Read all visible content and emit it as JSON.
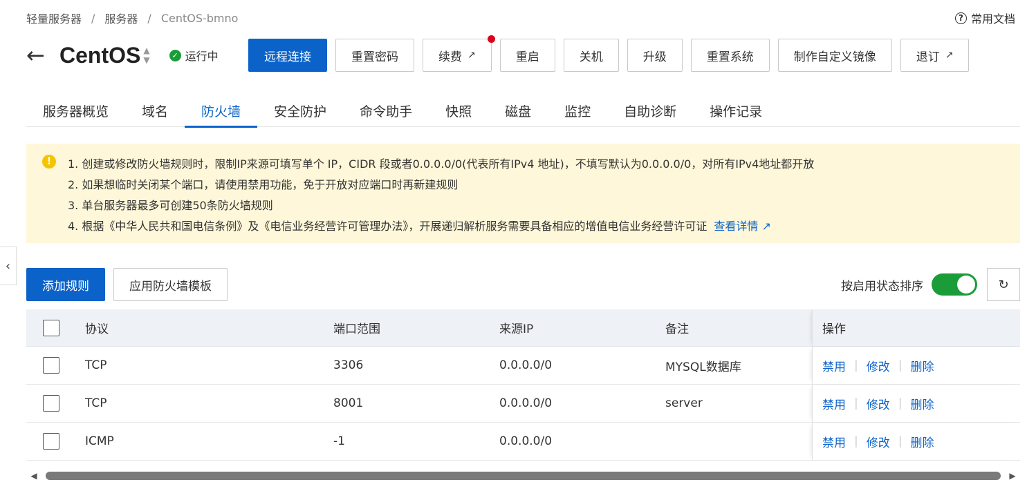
{
  "breadcrumb": [
    "轻量服务器",
    "服务器",
    "CentOS-bmno"
  ],
  "docs_link": "常用文档",
  "title": "CentOS",
  "status": "运行中",
  "actions": [
    {
      "label": "远程连接",
      "primary": true
    },
    {
      "label": "重置密码"
    },
    {
      "label": "续费",
      "external": true,
      "badge": true
    },
    {
      "label": "重启"
    },
    {
      "label": "关机"
    },
    {
      "label": "升级"
    },
    {
      "label": "重置系统"
    },
    {
      "label": "制作自定义镜像"
    },
    {
      "label": "退订",
      "external": true
    }
  ],
  "tabs": [
    "服务器概览",
    "域名",
    "防火墙",
    "安全防护",
    "命令助手",
    "快照",
    "磁盘",
    "监控",
    "自助诊断",
    "操作记录"
  ],
  "active_tab": "防火墙",
  "notice": {
    "lines": [
      "1. 创建或修改防火墙规则时，限制IP来源可填写单个 IP，CIDR 段或者0.0.0.0/0(代表所有IPv4 地址)，不填写默认为0.0.0.0/0，对所有IPv4地址都开放",
      "2. 如果想临时关闭某个端口，请使用禁用功能，免于开放对应端口时再新建规则",
      "3. 单台服务器最多可创建50条防火墙规则",
      "4. 根据《中华人民共和国电信条例》及《电信业务经营许可管理办法》，开展递归解析服务需要具备相应的增值电信业务经营许可证"
    ],
    "link": "查看详情"
  },
  "toolbar": {
    "add_rule": "添加规则",
    "apply_template": "应用防火墙模板",
    "sort_label": "按启用状态排序",
    "sort_enabled": true
  },
  "table": {
    "headers": {
      "protocol": "协议",
      "port": "端口范围",
      "source": "来源IP",
      "note": "备注",
      "ops": "操作"
    },
    "rows": [
      {
        "protocol": "TCP",
        "port": "3306",
        "source": "0.0.0.0/0",
        "note": "MYSQL数据库"
      },
      {
        "protocol": "TCP",
        "port": "8001",
        "source": "0.0.0.0/0",
        "note": "server"
      },
      {
        "protocol": "ICMP",
        "port": "-1",
        "source": "0.0.0.0/0",
        "note": ""
      }
    ],
    "ops": [
      "禁用",
      "修改",
      "删除"
    ]
  },
  "colors": {
    "primary": "#0b63c9",
    "success": "#1a9d39",
    "notice_bg": "#fff7d9",
    "badge": "#e0001a"
  }
}
